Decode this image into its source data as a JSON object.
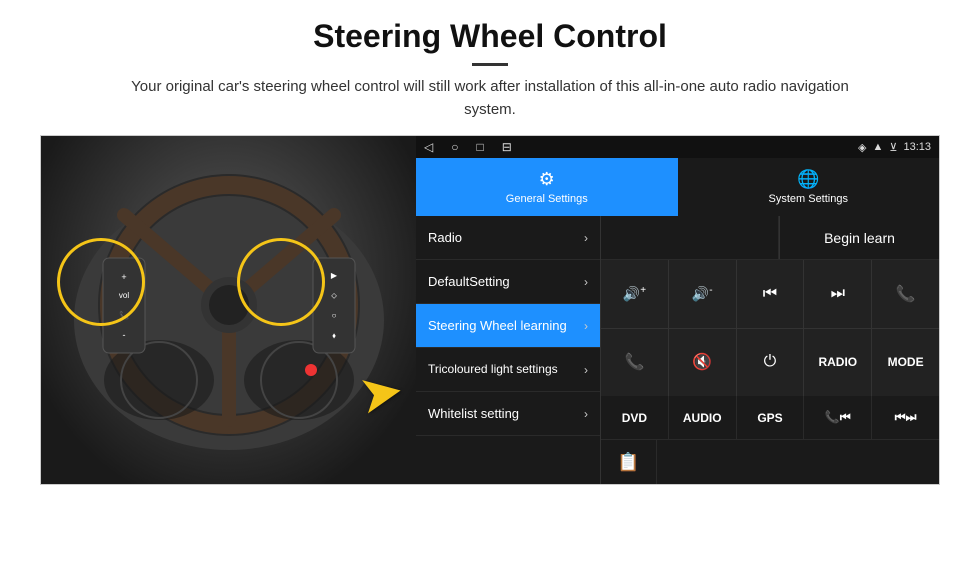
{
  "header": {
    "title": "Steering Wheel Control",
    "subtitle": "Your original car's steering wheel control will still work after installation of this all-in-one auto radio navigation system."
  },
  "statusBar": {
    "time": "13:13",
    "navButtons": [
      "◁",
      "○",
      "□",
      "⊟"
    ]
  },
  "tabs": [
    {
      "id": "general",
      "label": "General Settings",
      "icon": "⚙",
      "active": true
    },
    {
      "id": "system",
      "label": "System Settings",
      "icon": "🌐",
      "active": false
    }
  ],
  "menuItems": [
    {
      "id": "radio",
      "label": "Radio",
      "active": false
    },
    {
      "id": "default",
      "label": "DefaultSetting",
      "active": false
    },
    {
      "id": "steering",
      "label": "Steering Wheel learning",
      "active": true
    },
    {
      "id": "tricoloured",
      "label": "Tricoloured light settings",
      "active": false
    },
    {
      "id": "whitelist",
      "label": "Whitelist setting",
      "active": false
    }
  ],
  "beginLearnButton": "Begin learn",
  "controlButtons": [
    {
      "icon": "🔊+",
      "type": "icon"
    },
    {
      "icon": "🔊-",
      "type": "icon"
    },
    {
      "icon": "⏮",
      "type": "icon"
    },
    {
      "icon": "⏭",
      "type": "icon"
    },
    {
      "icon": "📞",
      "type": "icon"
    },
    {
      "icon": "📞",
      "type": "icon"
    },
    {
      "icon": "🔇",
      "type": "icon"
    },
    {
      "icon": "⏻",
      "type": "icon"
    },
    {
      "icon": "RADIO",
      "type": "text"
    },
    {
      "icon": "MODE",
      "type": "text"
    }
  ],
  "bottomButtons": [
    {
      "label": "DVD"
    },
    {
      "label": "AUDIO"
    },
    {
      "label": "GPS"
    },
    {
      "label": "📞⏮"
    },
    {
      "label": "⏮⏭"
    }
  ],
  "extraIcons": [
    {
      "icon": "📋"
    }
  ]
}
